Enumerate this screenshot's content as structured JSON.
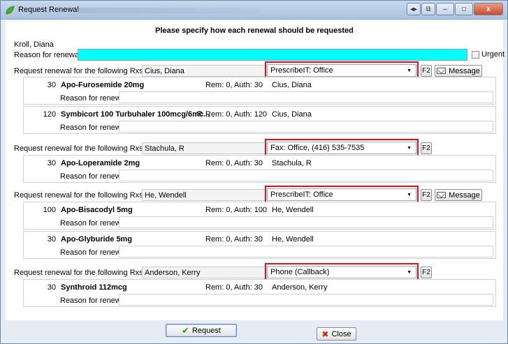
{
  "window": {
    "title": "Request Renewal",
    "controls": [
      "◂▸",
      "⧉",
      "–",
      "□",
      "x"
    ]
  },
  "header": {
    "instruction": "Please specify how each renewal should be requested"
  },
  "patient": {
    "name": "Kroll, Diana"
  },
  "reason_main": {
    "label": "Reason for renewal",
    "value": ""
  },
  "urgent": {
    "label": "Urgent",
    "checked": false
  },
  "group_label": "Request renewal for the following Rxs from",
  "rx_reason_label": "Reason for renewal",
  "f2_label": "F2",
  "message_label": "Message",
  "groups": [
    {
      "prescriber": "Cius, Diana",
      "method": "PrescribeIT: Office",
      "has_message": true,
      "rxs": [
        {
          "qty": "30",
          "drug": "Apo-Furosemide 20mg",
          "eye": false,
          "rem": "Rem: 0, Auth: 30",
          "prescriber": "Cius, Diana"
        },
        {
          "qty": "120",
          "drug": "Symbicort 100 Turbuhaler 100mcg/6mc...",
          "eye": true,
          "rem": "Rem: 0, Auth: 120",
          "prescriber": "Cius, Diana"
        }
      ]
    },
    {
      "prescriber": "Stachula, R",
      "method": "Fax: Office, (416) 535-7535",
      "has_message": false,
      "rxs": [
        {
          "qty": "30",
          "drug": "Apo-Loperamide 2mg",
          "eye": false,
          "rem": "Rem: 0, Auth: 30",
          "prescriber": "Stachula, R"
        }
      ]
    },
    {
      "prescriber": "He, Wendell",
      "method": "PrescribeIT: Office",
      "has_message": true,
      "rxs": [
        {
          "qty": "100",
          "drug": "Apo-Bisacodyl 5mg",
          "eye": false,
          "rem": "Rem: 0, Auth: 100",
          "prescriber": "He, Wendell"
        },
        {
          "qty": "30",
          "drug": "Apo-Glyburide 5mg",
          "eye": false,
          "rem": "Rem: 0, Auth: 30",
          "prescriber": "He, Wendell"
        }
      ]
    },
    {
      "prescriber": "Anderson, Kerry",
      "method": "Phone (Callback)",
      "has_message": false,
      "rxs": [
        {
          "qty": "30",
          "drug": "Synthroid 112mcg",
          "eye": false,
          "rem": "Rem: 0, Auth: 30",
          "prescriber": "Anderson, Kerry"
        }
      ]
    }
  ],
  "buttons": {
    "request": "Request",
    "close": "Close"
  },
  "colors": {
    "reason_highlight": "#00ffff",
    "annotation_red": "#e0101a",
    "accept_green": "#2e9a1f",
    "close_red": "#c0281c"
  }
}
